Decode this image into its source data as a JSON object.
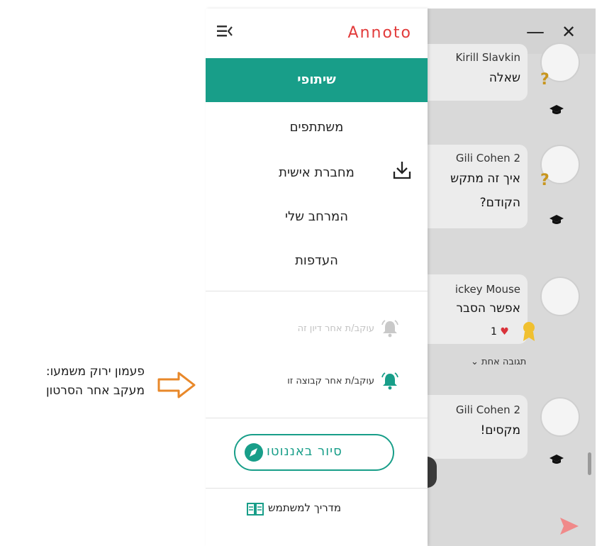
{
  "annotation": {
    "line1": "פעמון ירוק משמעו:",
    "line2": "מעקב אחר הסרטון"
  },
  "menu": {
    "logo": "Annoto",
    "items": [
      {
        "label": "שיתופי",
        "active": true
      },
      {
        "label": "משתתפים",
        "active": false
      },
      {
        "label": "מחברת אישית",
        "active": false
      },
      {
        "label": "המרחב שלי",
        "active": false
      },
      {
        "label": "העדפות",
        "active": false
      }
    ],
    "follow_discussion": "עוקב/ת אחר דיון זה",
    "follow_group": "עוקב/ת אחר קבוצה זו",
    "tour_label": "סיור באננוטו",
    "user_guide": "מדריך למשתמש"
  },
  "background": {
    "window_controls": {
      "minimize": "—",
      "close": "✕"
    },
    "posts": [
      {
        "author": "Kirill Slavkin",
        "lines": [
          "שאלה"
        ]
      },
      {
        "author": "2 Gili Cohen",
        "lines": [
          "איך זה מתקש",
          "הקודם?"
        ]
      },
      {
        "author": "ickey Mouse",
        "lines": [
          "אפשר הסבר"
        ],
        "likes": "1"
      },
      {
        "author": "2 Gili Cohen",
        "lines": [
          "מקסים!"
        ]
      }
    ],
    "reply_toggle": "תגובה אחת ⌄"
  },
  "colors": {
    "accent": "#189e89",
    "logo": "#e23b3b",
    "annotation_arrow": "#e8882a",
    "bell_active": "#189e89",
    "bell_inactive": "#c9c9c9",
    "send": "#f08a8a"
  }
}
